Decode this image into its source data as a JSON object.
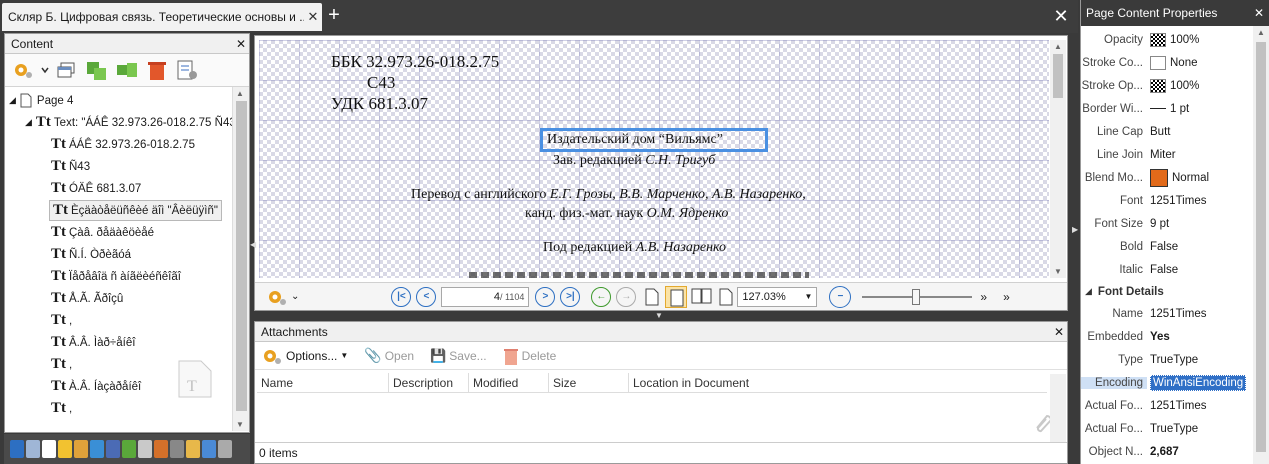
{
  "tab": {
    "title": "Скляр Б. Цифровая связь. Теоретические основы и ..",
    "close": "✕",
    "new_tab": "+",
    "window_close": "✕"
  },
  "content_panel": {
    "title": "Content",
    "close": "✕",
    "tree": [
      {
        "label": "Page 4",
        "kind": "page"
      },
      {
        "label": "Text: \"ÁÁÊ 32.973.26-018.2.75 Ñ43",
        "kind": "text-group"
      },
      {
        "label": "ÁÁÊ 32.973.26-018.2.75",
        "kind": "text"
      },
      {
        "label": "Ñ43",
        "kind": "text"
      },
      {
        "label": "ÓÄÊ 681.3.07",
        "kind": "text"
      },
      {
        "label": "Èçäàòåëüñêèé äîì \"Âèëüÿìñ\"",
        "kind": "text",
        "selected": true
      },
      {
        "label": "Çàâ. ðåäàêöèåé",
        "kind": "text"
      },
      {
        "label": "Ñ.Í. Òðèãóá",
        "kind": "text"
      },
      {
        "label": "Ïåðåâîä ñ àíãëèéñêîãî",
        "kind": "text"
      },
      {
        "label": "Å.Ã. Ãðîçû",
        "kind": "text"
      },
      {
        "label": ",",
        "kind": "text"
      },
      {
        "label": "Â.Â. Ìàð÷åíêî",
        "kind": "text"
      },
      {
        "label": ",",
        "kind": "text"
      },
      {
        "label": "À.Â. Íàçàðåíêî",
        "kind": "text"
      },
      {
        "label": ",",
        "kind": "text"
      }
    ]
  },
  "document": {
    "lines": {
      "bbk": "ББК 32.973.26-018.2.75",
      "c43": "С43",
      "udk": "УДК 681.3.07",
      "publisher": "Издательский дом “Вильямс”",
      "editor_label": "Зав. редакцией ",
      "editor_name": "С.Н. Тригуб",
      "translation_label": "Перевод с английского ",
      "translators": "Е.Г. Грозы, В.В. Марченко, А.В. Назаренко,",
      "degree_label": "канд. физ.-мат. наук ",
      "degree_name": "О.М. Ядренко",
      "edited_label": "Под редакцией ",
      "edited_name": "А.В. Назаренко"
    },
    "page_current": "4",
    "page_total": "/ 1104",
    "zoom": "127.03%"
  },
  "attachments": {
    "title": "Attachments",
    "close": "✕",
    "toolbar": {
      "options": "Options...",
      "open": "Open",
      "save": "Save...",
      "delete": "Delete"
    },
    "columns": [
      "Name",
      "Description",
      "Modified",
      "Size",
      "Location in Document"
    ],
    "status": "0 items"
  },
  "properties": {
    "title": "Page Content Properties",
    "close": "✕",
    "rows": [
      {
        "key": "Opacity",
        "value": "100%",
        "swatch": "checker"
      },
      {
        "key": "Stroke Co...",
        "value": "None",
        "swatch": "checker"
      },
      {
        "key": "Stroke Op...",
        "value": "100%",
        "swatch": "checker"
      },
      {
        "key": "Border Wi...",
        "value": "1 pt",
        "swatch": "line"
      },
      {
        "key": "Line Cap",
        "value": "Butt"
      },
      {
        "key": "Line Join",
        "value": "Miter"
      },
      {
        "key": "Blend Mo...",
        "value": "Normal",
        "swatch": "orange"
      },
      {
        "key": "Font",
        "value": "1251Times"
      },
      {
        "key": "Font Size",
        "value": "9 pt"
      },
      {
        "key": "Bold",
        "value": "False"
      },
      {
        "key": "Italic",
        "value": "False"
      }
    ],
    "section": "Font Details",
    "details": [
      {
        "key": "Name",
        "value": "1251Times"
      },
      {
        "key": "Embedded",
        "value": "Yes",
        "bold": true
      },
      {
        "key": "Type",
        "value": "TrueType"
      },
      {
        "key": "Encoding",
        "value": "WinAnsiEncoding",
        "highlight": true
      },
      {
        "key": "Actual Fo...",
        "value": "1251Times"
      },
      {
        "key": "Actual Fo...",
        "value": "TrueType"
      },
      {
        "key": "Object N...",
        "value": "2,687",
        "bold": true
      }
    ]
  },
  "colors": {
    "accent": "#2d6fc2",
    "selection": "#4a90e2",
    "highlight": "#2f6fc6"
  }
}
